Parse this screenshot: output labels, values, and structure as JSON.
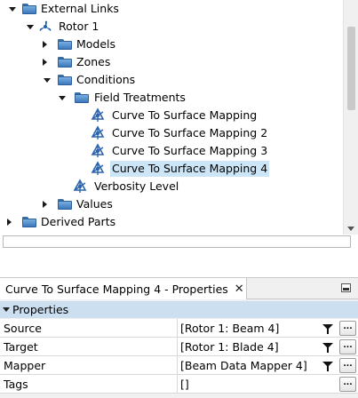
{
  "tree": {
    "items": [
      {
        "label": "External Links",
        "icon": "folder-icon"
      },
      {
        "label": "Rotor 1",
        "icon": "rotor-icon"
      },
      {
        "label": "Models",
        "icon": "folder-icon"
      },
      {
        "label": "Zones",
        "icon": "folder-icon"
      },
      {
        "label": "Conditions",
        "icon": "folder-icon"
      },
      {
        "label": "Field Treatments",
        "icon": "folder-icon"
      },
      {
        "label": "Curve To Surface Mapping",
        "icon": "mapping-icon"
      },
      {
        "label": "Curve To Surface Mapping 2",
        "icon": "mapping-icon"
      },
      {
        "label": "Curve To Surface Mapping 3",
        "icon": "mapping-icon"
      },
      {
        "label": "Curve To Surface Mapping 4",
        "icon": "mapping-icon",
        "selected": true
      },
      {
        "label": "Verbosity Level",
        "icon": "mapping-icon"
      },
      {
        "label": "Values",
        "icon": "folder-icon"
      },
      {
        "label": "Derived Parts",
        "icon": "folder-icon"
      }
    ]
  },
  "properties": {
    "tab_title": "Curve To Surface Mapping 4 - Properties",
    "close_glyph": "✕",
    "section_title": "Properties",
    "ellipsis_label": "...",
    "rows": [
      {
        "name": "Source",
        "value": "[Rotor 1: Beam 4]"
      },
      {
        "name": "Target",
        "value": "[Rotor 1: Blade 4]"
      },
      {
        "name": "Mapper",
        "value": "[Beam Data Mapper 4]"
      },
      {
        "name": "Tags",
        "value": "[]"
      }
    ]
  },
  "colors": {
    "selection": "#cde6f7",
    "section_header": "#ccdff0",
    "folder": "#3b78bd"
  }
}
